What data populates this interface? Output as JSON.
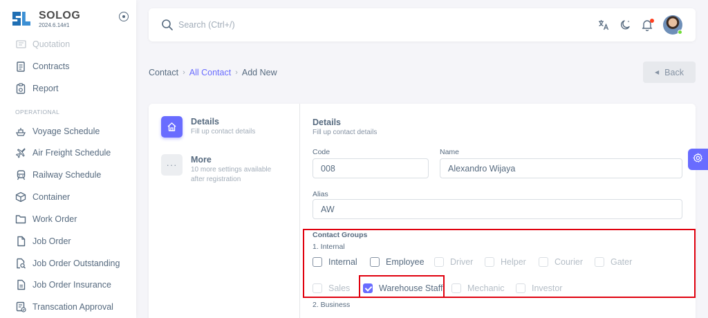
{
  "brand": {
    "name": "SOLOG",
    "version": "2024.6.14#1",
    "logo_sub": "LOG"
  },
  "sidebar": {
    "top_items": [
      {
        "label": "Quotation",
        "icon": "quotation-icon"
      },
      {
        "label": "Contracts",
        "icon": "contract-icon"
      },
      {
        "label": "Report",
        "icon": "report-icon"
      }
    ],
    "section_header": "OPERATIONAL",
    "items": [
      {
        "label": "Voyage Schedule",
        "icon": "ship-icon"
      },
      {
        "label": "Air Freight Schedule",
        "icon": "plane-icon"
      },
      {
        "label": "Railway Schedule",
        "icon": "train-icon"
      },
      {
        "label": "Container",
        "icon": "box-icon"
      },
      {
        "label": "Work Order",
        "icon": "folder-icon"
      },
      {
        "label": "Job Order",
        "icon": "file-icon"
      },
      {
        "label": "Job Order Outstanding",
        "icon": "file-search-icon"
      },
      {
        "label": "Job Order Insurance",
        "icon": "file-text-icon"
      },
      {
        "label": "Transcation Approval",
        "icon": "approval-icon"
      }
    ]
  },
  "navbar": {
    "search_placeholder": "Search (Ctrl+/)"
  },
  "breadcrumb": {
    "root": "Contact",
    "link": "All Contact",
    "current": "Add New"
  },
  "back_label": "Back",
  "steps": [
    {
      "title": "Details",
      "subtitle": "Fill up contact details",
      "active": true
    },
    {
      "title": "More",
      "subtitle": "10 more settings available after registration",
      "active": false
    }
  ],
  "form": {
    "title": "Details",
    "subtitle": "Fill up contact details",
    "code_label": "Code",
    "code_value": "008",
    "name_label": "Name",
    "name_value": "Alexandro Wijaya",
    "alias_label": "Alias",
    "alias_value": "AW",
    "groups_title": "Contact Groups",
    "internal_label": "1. Internal",
    "business_label": "2. Business",
    "internal_groups": [
      {
        "label": "Internal",
        "enabled": true,
        "checked": false
      },
      {
        "label": "Employee",
        "enabled": true,
        "checked": false
      },
      {
        "label": "Driver",
        "enabled": false,
        "checked": false
      },
      {
        "label": "Helper",
        "enabled": false,
        "checked": false
      },
      {
        "label": "Courier",
        "enabled": false,
        "checked": false
      },
      {
        "label": "Gater",
        "enabled": false,
        "checked": false
      },
      {
        "label": "Sales",
        "enabled": false,
        "checked": false
      },
      {
        "label": "Warehouse Staff",
        "enabled": true,
        "checked": true
      },
      {
        "label": "Mechanic",
        "enabled": false,
        "checked": false
      },
      {
        "label": "Investor",
        "enabled": false,
        "checked": false
      }
    ]
  },
  "colors": {
    "primary": "#696cff",
    "highlight": "#e0000e",
    "text": "#566a7f"
  }
}
